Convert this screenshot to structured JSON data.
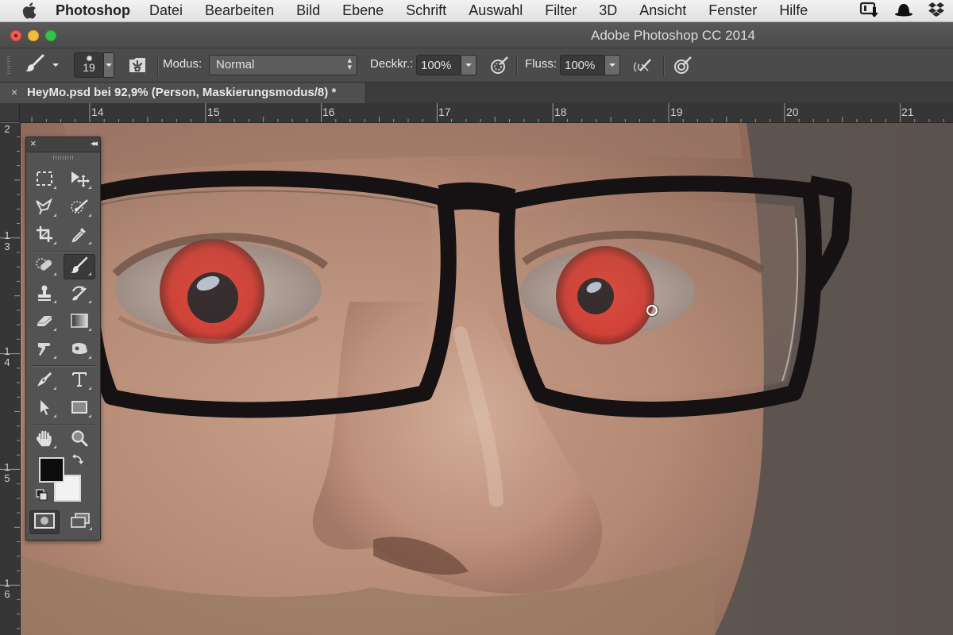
{
  "menubar": {
    "app_name": "Photoshop",
    "items": [
      "Datei",
      "Bearbeiten",
      "Bild",
      "Ebene",
      "Schrift",
      "Auswahl",
      "Filter",
      "3D",
      "Ansicht",
      "Fenster",
      "Hilfe"
    ],
    "tray_icons": [
      "pen-tablet-icon",
      "bowler-hat-icon",
      "dropbox-icon"
    ]
  },
  "window": {
    "title": "Adobe Photoshop CC 2014"
  },
  "options_bar": {
    "tool_preset_icon": "brush-icon",
    "brush_size": "19",
    "mode_label": "Modus:",
    "mode_value": "Normal",
    "opacity_label": "Deckkr.:",
    "opacity_value": "100%",
    "flow_label": "Fluss:",
    "flow_value": "100%",
    "icons": [
      "brush-panel-icon",
      "pressure-opacity-icon",
      "airbrush-icon",
      "pressure-size-icon"
    ]
  },
  "document": {
    "tab_title": "HeyMo.psd bei 92,9% (Person, Maskierungsmodus/8) *",
    "close_label": "×"
  },
  "rulers": {
    "horizontal": [
      "14",
      "15",
      "16",
      "17",
      "18",
      "19",
      "20",
      "21"
    ],
    "vertical": [
      [
        "2"
      ],
      [
        "1",
        "3"
      ],
      [
        "1",
        "4"
      ],
      [
        "1",
        "5"
      ],
      [
        "1",
        "6"
      ]
    ]
  },
  "toolbox": {
    "close_label": "×",
    "collapse_label": "◂◂",
    "tools": [
      {
        "name": "rectangular-marquee-tool",
        "icon": "marquee-icon"
      },
      {
        "name": "move-tool",
        "icon": "move-icon"
      },
      {
        "name": "lasso-tool",
        "icon": "polygonal-lasso-icon"
      },
      {
        "name": "quick-selection-tool",
        "icon": "quick-selection-icon"
      },
      {
        "name": "crop-tool",
        "icon": "crop-icon"
      },
      {
        "name": "eyedropper-tool",
        "icon": "eyedropper-icon"
      },
      {
        "name": "spot-healing-tool",
        "icon": "healing-bandage-icon"
      },
      {
        "name": "brush-tool",
        "icon": "brush-icon",
        "active": true
      },
      {
        "name": "clone-stamp-tool",
        "icon": "stamp-icon"
      },
      {
        "name": "history-brush-tool",
        "icon": "history-brush-icon"
      },
      {
        "name": "eraser-tool",
        "icon": "eraser-icon"
      },
      {
        "name": "gradient-tool",
        "icon": "gradient-icon"
      },
      {
        "name": "smudge-tool",
        "icon": "smudge-finger-icon"
      },
      {
        "name": "dodge-tool",
        "icon": "sponge-icon"
      },
      {
        "name": "pen-tool",
        "icon": "pen-nib-icon"
      },
      {
        "name": "type-tool",
        "icon": "type-T-icon"
      },
      {
        "name": "path-selection-tool",
        "icon": "arrow-pointer-icon"
      },
      {
        "name": "rectangle-shape-tool",
        "icon": "rectangle-icon"
      },
      {
        "name": "hand-tool",
        "icon": "hand-icon"
      },
      {
        "name": "zoom-tool",
        "icon": "magnifier-icon"
      }
    ],
    "foreground_color": "#0d0d0d",
    "background_color": "#f2f2f2",
    "quick_mask_mode": "active"
  },
  "colors": {
    "ui_dark": "#535353",
    "iris_red": "#d8302a",
    "skin": "#b98e7a",
    "backdrop": "#5e5550"
  }
}
